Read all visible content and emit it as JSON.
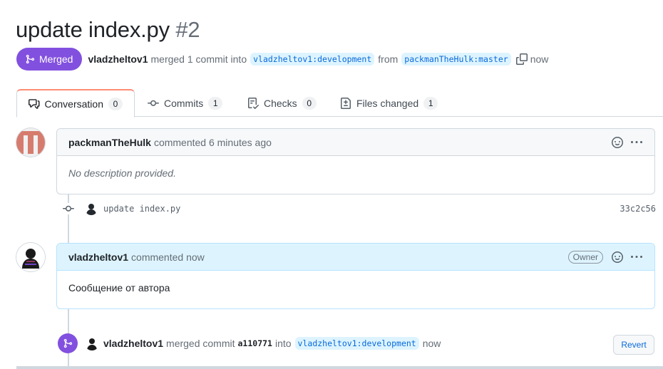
{
  "pr": {
    "title": "update index.py",
    "number": "#2",
    "state_label": "Merged",
    "author": "vladzheltov1",
    "action_text": "merged 1 commit into",
    "base_branch": "vladzheltov1:development",
    "from_text": "from",
    "head_branch": "packmanTheHulk:master",
    "time": "now"
  },
  "tabs": [
    {
      "label": "Conversation",
      "count": "0",
      "icon": "comment-discussion-icon"
    },
    {
      "label": "Commits",
      "count": "1",
      "icon": "git-commit-icon"
    },
    {
      "label": "Checks",
      "count": "0",
      "icon": "checklist-icon"
    },
    {
      "label": "Files changed",
      "count": "1",
      "icon": "file-diff-icon"
    }
  ],
  "comments": [
    {
      "author": "packmanTheHulk",
      "meta": "commented 6 minutes ago",
      "body": "No description provided.",
      "role": ""
    },
    {
      "author": "vladzheltov1",
      "meta": "commented now",
      "body": "Сообщение от автора",
      "role": "Owner"
    }
  ],
  "commit": {
    "message": "update index.py",
    "sha": "33c2c56"
  },
  "merge_event": {
    "author": "vladzheltov1",
    "action": "merged commit",
    "sha": "a110771",
    "into_text": "into",
    "branch": "vladzheltov1:development",
    "time": "now",
    "revert_label": "Revert"
  },
  "colors": {
    "merged": "#8250df",
    "branch_bg": "#ddf4ff",
    "branch_text": "#0969da",
    "tab_accent": "#fd8c73"
  }
}
